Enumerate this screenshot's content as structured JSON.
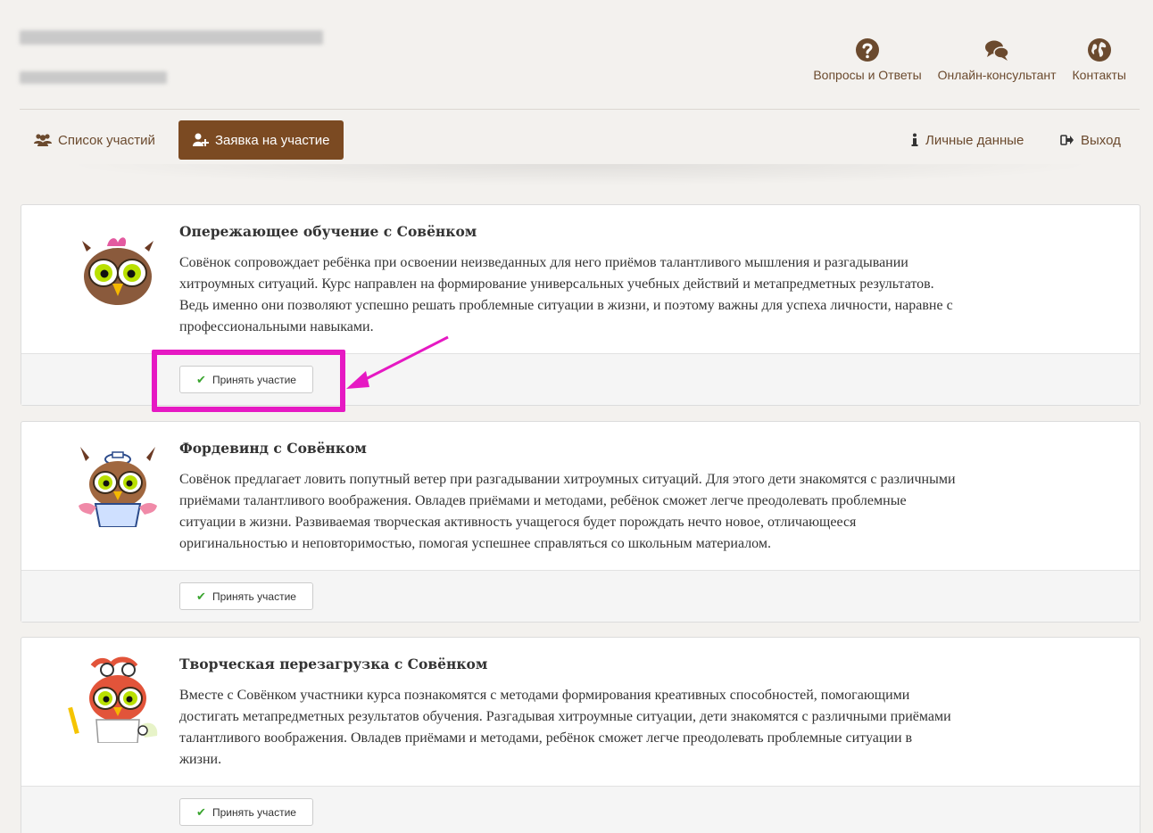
{
  "header": {
    "links": [
      {
        "icon": "question-circle-icon",
        "label": "Вопросы и Ответы"
      },
      {
        "icon": "chat-bubbles-icon",
        "label": "Онлайн-консультант"
      },
      {
        "icon": "globe-icon",
        "label": "Контакты"
      }
    ]
  },
  "nav": {
    "list_label": "Список участий",
    "apply_label": "Заявка на участие",
    "personal_label": "Личные данные",
    "logout_label": "Выход"
  },
  "courses": [
    {
      "title": "Опережающее обучение с Совёнком",
      "lines": [
        "Совёнок сопровождает ребёнка при освоении неизведанных для него приёмов талантливого мышления и разгадывании",
        "хитроумных ситуаций. Курс направлен на формирование универсальных учебных действий и метапредметных результатов.",
        "Ведь именно они позволяют успешно решать проблемные ситуации в жизни, и поэтому важны для успеха личности, наравне с",
        "профессиональными навыками."
      ],
      "button": "Принять участие"
    },
    {
      "title": "Фордевинд с Совёнком",
      "lines": [
        "Совёнок предлагает ловить попутный ветер при разгадывании хитроумных ситуаций. Для этого дети знакомятся с различными",
        "приёмами талантливого воображения. Овладев приёмами и методами, ребёнок сможет легче преодолевать проблемные",
        "ситуации в жизни. Развиваемая творческая активность учащегося будет порождать нечто новое, отличающееся",
        "оригинальностью и неповторимостью, помогая успешнее справляться со школьным материалом."
      ],
      "button": "Принять участие"
    },
    {
      "title": "Творческая перезагрузка с Совёнком",
      "lines": [
        "Вместе с Совёнком участники курса познакомятся с методами формирования креативных способностей, помогающими",
        "достигать метапредметных результатов обучения. Разгадывая хитроумные ситуации, дети знакомятся с различными приёмами",
        "талантливого воображения. Овладев приёмами и методами, ребёнок сможет легче преодолевать проблемные ситуации в",
        "жизни."
      ],
      "button": "Принять участие"
    }
  ],
  "colors": {
    "brand": "#7b4a22",
    "link": "#6b4a2e",
    "check": "#3aa52f",
    "highlight": "#e619c3"
  }
}
